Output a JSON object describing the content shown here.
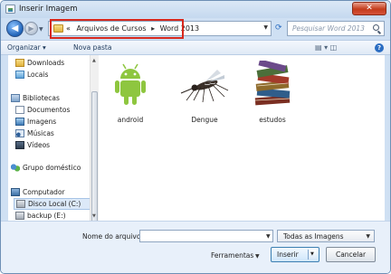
{
  "window": {
    "title": "Inserir Imagem",
    "close_glyph": "✕"
  },
  "address": {
    "prefix": "«",
    "crumbs": [
      "Arquivos de Cursos",
      "Word 2013"
    ],
    "separator": "▸",
    "search_placeholder": "Pesquisar Word 2013"
  },
  "toolbar": {
    "organize": "Organizar ▾",
    "new_folder": "Nova pasta",
    "view_icons": "▤ ▾   ◫",
    "help": "?"
  },
  "nav": {
    "items": [
      {
        "label": "Downloads",
        "icon": "downloads-folder-icon"
      },
      {
        "label": "Locais",
        "icon": "places-icon"
      },
      {
        "label": "Bibliotecas",
        "icon": "libraries-icon"
      },
      {
        "label": "Documentos",
        "icon": "documents-icon"
      },
      {
        "label": "Imagens",
        "icon": "pictures-icon"
      },
      {
        "label": "Músicas",
        "icon": "music-icon"
      },
      {
        "label": "Vídeos",
        "icon": "videos-icon"
      },
      {
        "label": "Grupo doméstico",
        "icon": "homegroup-icon"
      },
      {
        "label": "Computador",
        "icon": "computer-icon"
      },
      {
        "label": "Disco Local (C:)",
        "icon": "local-disk-icon"
      },
      {
        "label": "backup (E:)",
        "icon": "backup-disk-icon"
      }
    ]
  },
  "files": [
    {
      "name": "android",
      "icon": "android-robot-image"
    },
    {
      "name": "Dengue",
      "icon": "mosquito-image"
    },
    {
      "name": "estudos",
      "icon": "books-image"
    }
  ],
  "bottom": {
    "filename_label": "Nome do arquivo:",
    "filename_value": "",
    "filter_value": "Todas as Imagens",
    "tools_label": "Ferramentas",
    "insert_label": "Inserir",
    "cancel_label": "Cancelar"
  },
  "colors": {
    "highlight_border": "#d7281d",
    "android_green": "#8ec63f",
    "close_red": "#c43c1b"
  }
}
